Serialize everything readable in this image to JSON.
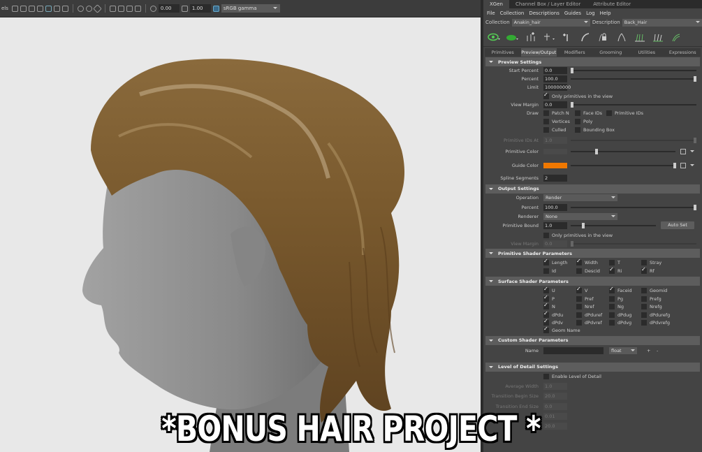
{
  "viewport_toolbar": {
    "label_fragment": "els",
    "num1": "0.00",
    "num2": "1.00",
    "colorspace": "sRGB gamma"
  },
  "panel_tabs": [
    "XGen",
    "Channel Box / Layer Editor",
    "Attribute Editor"
  ],
  "menu": [
    "File",
    "Collection",
    "Descriptions",
    "Guides",
    "Log",
    "Help"
  ],
  "collection": {
    "label": "Collection",
    "value": "Anakin_hair"
  },
  "description": {
    "label": "Description",
    "value": "Back_Hair"
  },
  "subtabs": [
    "Primitives",
    "Preview/Output",
    "Modifiers",
    "Grooming",
    "Utilities",
    "Expressions"
  ],
  "preview": {
    "title": "Preview Settings",
    "start_percent_label": "Start Percent",
    "start_percent": "0.0",
    "percent_label": "Percent",
    "percent": "100.0",
    "limit_label": "Limit",
    "limit": "100000000",
    "only_prims": "Only primitives in the view",
    "view_margin_label": "View Margin",
    "view_margin": "0.0",
    "draw_label": "Draw",
    "draw_opts": [
      "Patch N",
      "Face IDs",
      "Primitive IDs",
      "Vertices",
      "Poly",
      "Culled",
      "Bounding Box"
    ],
    "prim_ids_at_label": "Primitive IDs At",
    "prim_ids_at": "1.0",
    "prim_color_label": "Primitive Color",
    "guide_color_label": "Guide Color",
    "spline_segments_label": "Spline Segments",
    "spline_segments": "2"
  },
  "output": {
    "title": "Output Settings",
    "operation_label": "Operation",
    "operation": "Render",
    "percent_label": "Percent",
    "percent": "100.0",
    "renderer_label": "Renderer",
    "renderer": "None",
    "prim_bound_label": "Primitive Bound",
    "prim_bound": "1.0",
    "auto_set": "Auto Set",
    "only_prims": "Only primitives in the view",
    "view_margin_label": "View Margin",
    "view_margin": "0.0"
  },
  "prim_shader": {
    "title": "Primitive Shader Parameters",
    "params": [
      "Length",
      "Width",
      "T",
      "Stray",
      "Id",
      "Descid",
      "Ri",
      "Rf"
    ]
  },
  "surf_shader": {
    "title": "Surface Shader Parameters",
    "params": [
      "U",
      "V",
      "Faceid",
      "Geomid",
      "P",
      "Pref",
      "Pg",
      "Prefg",
      "N",
      "Nref",
      "Ng",
      "Nrefg",
      "dPdu",
      "dPduref",
      "dPdug",
      "dPdurefg",
      "dPdv",
      "dPdvref",
      "dPdvg",
      "dPdvrefg",
      "Geom Name"
    ]
  },
  "custom_shader": {
    "title": "Custom Shader Parameters",
    "name_label": "Name",
    "type": "float",
    "plus": "+",
    "minus": "-"
  },
  "lod": {
    "title": "Level of Detail Settings",
    "enable": "Enable Level of Detail",
    "avg_width_label": "Average Width",
    "avg_width": "1.0",
    "trans_begin_label": "Transition Begin Size",
    "trans_begin": "20.0",
    "trans_end_label": "Transition End Size",
    "trans_end": "0.0",
    "v4": "0.01",
    "v5": "20.0"
  },
  "caption": "*BONUS HAIR PROJECT *",
  "colors": {
    "guide": "#f07800",
    "hair": "#7a5a30",
    "skin": "#8e8e8e"
  }
}
